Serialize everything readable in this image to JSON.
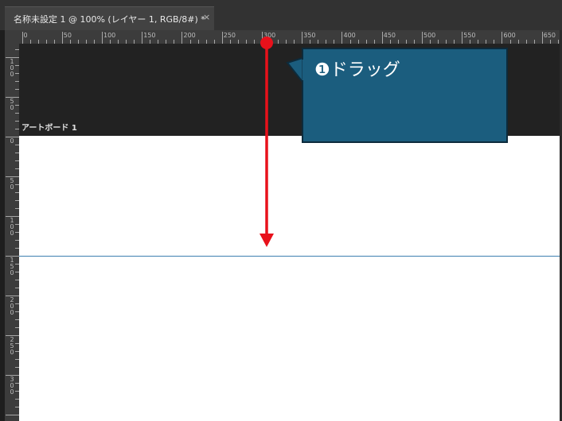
{
  "tab": {
    "title": "名称未設定 1 @ 100% (レイヤー 1, RGB/8#) *",
    "close_glyph": "×"
  },
  "ruler": {
    "horizontal_labels": [
      "0",
      "50",
      "100",
      "150",
      "200",
      "250",
      "300",
      "350",
      "400",
      "450",
      "500",
      "550",
      "600",
      "650"
    ],
    "vertical_labels": [
      "100",
      "50",
      "0",
      "50",
      "100",
      "150",
      "200",
      "250",
      "300"
    ]
  },
  "canvas": {
    "artboard_label": "アートボード 1",
    "guide_color": "#3d7fb0",
    "artboard_color": "#ffffff",
    "pasteboard_color": "#222222"
  },
  "annotation": {
    "callout_text": "❶ドラッグ",
    "callout_color": "#1b5d7e",
    "arrow_color": "#e8111b",
    "arrow_icon": "drag-down-arrow-icon"
  }
}
